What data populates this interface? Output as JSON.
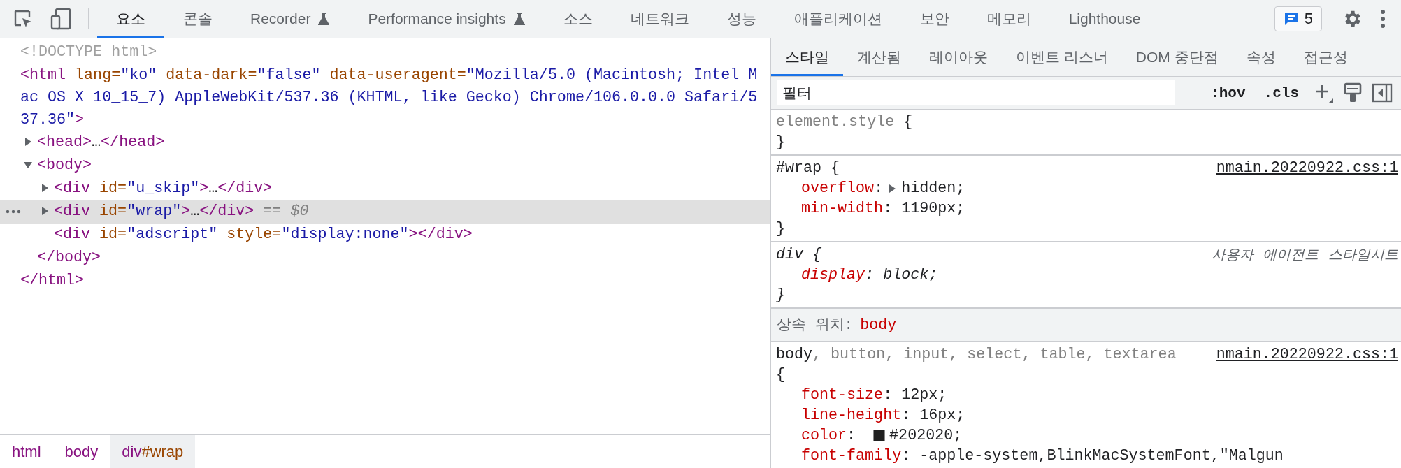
{
  "toolbar": {
    "tabs": [
      {
        "label": "요소",
        "selected": true,
        "experimental": false
      },
      {
        "label": "콘솔",
        "selected": false,
        "experimental": false
      },
      {
        "label": "Recorder",
        "selected": false,
        "experimental": true
      },
      {
        "label": "Performance insights",
        "selected": false,
        "experimental": true
      },
      {
        "label": "소스",
        "selected": false,
        "experimental": false
      },
      {
        "label": "네트워크",
        "selected": false,
        "experimental": false
      },
      {
        "label": "성능",
        "selected": false,
        "experimental": false
      },
      {
        "label": "애플리케이션",
        "selected": false,
        "experimental": false
      },
      {
        "label": "보안",
        "selected": false,
        "experimental": false
      },
      {
        "label": "메모리",
        "selected": false,
        "experimental": false
      },
      {
        "label": "Lighthouse",
        "selected": false,
        "experimental": false
      }
    ],
    "issues": {
      "count": "5"
    }
  },
  "dom_tree": {
    "nodes": [
      {
        "selected": false,
        "tokens": [
          {
            "kind": "comment",
            "t": "<!DOCTYPE html>"
          }
        ]
      },
      {
        "selected": false,
        "tokens": [
          {
            "kind": "tag",
            "t": "<html"
          },
          {
            "kind": "attr",
            "t": " lang="
          },
          {
            "kind": "val",
            "t": "\"ko\""
          },
          {
            "kind": "attr",
            "t": " data-dark="
          },
          {
            "kind": "val",
            "t": "\"false\""
          },
          {
            "kind": "attr",
            "t": " data-useragent="
          },
          {
            "kind": "val",
            "t": "\"Mozilla/5.0 (Macintosh; Intel Mac OS X 10_15_7) AppleWebKit/537.36 (KHTML, like Gecko) Chrome/106.0.0.0 Safari/537.36\""
          },
          {
            "kind": "tag",
            "t": ">"
          }
        ],
        "children": [
          {
            "selected": false,
            "expanded": false,
            "tokens": [
              {
                "kind": "tag",
                "t": "<head>"
              },
              {
                "kind": "text",
                "t": "…"
              },
              {
                "kind": "tag",
                "t": "</head>"
              }
            ]
          },
          {
            "selected": false,
            "expanded": true,
            "tokens": [
              {
                "kind": "tag",
                "t": "<body>"
              }
            ],
            "children": [
              {
                "selected": false,
                "expanded": false,
                "tokens": [
                  {
                    "kind": "tag",
                    "t": "<div"
                  },
                  {
                    "kind": "attr",
                    "t": " id="
                  },
                  {
                    "kind": "val",
                    "t": "\"u_skip\""
                  },
                  {
                    "kind": "tag",
                    "t": ">"
                  },
                  {
                    "kind": "text",
                    "t": "…"
                  },
                  {
                    "kind": "tag",
                    "t": "</div>"
                  }
                ]
              },
              {
                "selected": true,
                "expanded": false,
                "tokens": [
                  {
                    "kind": "tag",
                    "t": "<div"
                  },
                  {
                    "kind": "attr",
                    "t": " id="
                  },
                  {
                    "kind": "val",
                    "t": "\"wrap\""
                  },
                  {
                    "kind": "tag",
                    "t": ">"
                  },
                  {
                    "kind": "text",
                    "t": "…"
                  },
                  {
                    "kind": "tag",
                    "t": "</div>"
                  },
                  {
                    "kind": "hint",
                    "t": " == "
                  },
                  {
                    "kind": "var",
                    "t": "$0"
                  }
                ]
              },
              {
                "selected": false,
                "tokens": [
                  {
                    "kind": "tag",
                    "t": "<div"
                  },
                  {
                    "kind": "attr",
                    "t": " id="
                  },
                  {
                    "kind": "val",
                    "t": "\"adscript\""
                  },
                  {
                    "kind": "attr",
                    "t": " style="
                  },
                  {
                    "kind": "val",
                    "t": "\"display:none\""
                  },
                  {
                    "kind": "tag",
                    "t": "></div>"
                  }
                ]
              }
            ],
            "close": [
              {
                "kind": "tag",
                "t": "</body>"
              }
            ]
          }
        ],
        "close": [
          {
            "kind": "tag",
            "t": "</html>"
          }
        ]
      }
    ]
  },
  "breadcrumbs": [
    {
      "tag": "html",
      "selected": false
    },
    {
      "tag": "body",
      "selected": false
    },
    {
      "tag": "div",
      "id": "#wrap",
      "selected": true
    }
  ],
  "styles": {
    "tabs": [
      {
        "label": "스타일",
        "selected": true
      },
      {
        "label": "계산됨",
        "selected": false
      },
      {
        "label": "레이아웃",
        "selected": false
      },
      {
        "label": "이벤트 리스너",
        "selected": false
      },
      {
        "label": "DOM 중단점",
        "selected": false
      },
      {
        "label": "속성",
        "selected": false
      },
      {
        "label": "접근성",
        "selected": false
      }
    ],
    "filter": {
      "placeholder": "필터"
    },
    "actions": [
      ":hov",
      ".cls"
    ],
    "rules": [
      {
        "kind": "inline",
        "selector": [
          {
            "t": "element.style"
          }
        ],
        "open": "{",
        "close": "}"
      },
      {
        "kind": "author",
        "selector": [
          {
            "t": "#wrap"
          }
        ],
        "open": "{",
        "close": "}",
        "source": "nmain.20220922.css:1",
        "properties": [
          {
            "name": "overflow",
            "sep": ":",
            "value": "hidden;",
            "expandable": true
          },
          {
            "name": "min-width",
            "sep": ":",
            "value": "1190px;",
            "expandable": false
          }
        ]
      },
      {
        "kind": "user-agent",
        "selector": [
          {
            "t": "div"
          }
        ],
        "open": "{",
        "close": "}",
        "source": "사용자 에이전트 스타일시트",
        "properties": [
          {
            "name": "display",
            "sep": ":",
            "value": "block;",
            "expandable": false
          }
        ]
      },
      {
        "kind": "inherited",
        "label": "상속 위치:",
        "element": "body"
      },
      {
        "kind": "author",
        "selector": [
          {
            "t": "body",
            "matched": true
          },
          {
            "t": ", button, input, select, table, textarea",
            "matched": false
          }
        ],
        "open": "{",
        "source": "nmain.20220922.css:1",
        "properties": [
          {
            "name": "font-size",
            "sep": ":",
            "value": "12px;",
            "expandable": false
          },
          {
            "name": "line-height",
            "sep": ":",
            "value": "16px;",
            "expandable": false
          },
          {
            "name": "color",
            "sep": ":",
            "color": "#202020",
            "value": "#202020;",
            "expandable": false
          },
          {
            "name": "font-family",
            "sep": ":",
            "value": "-apple-system,BlinkMacSystemFont,\"Malgun",
            "expandable": false
          }
        ]
      }
    ]
  }
}
